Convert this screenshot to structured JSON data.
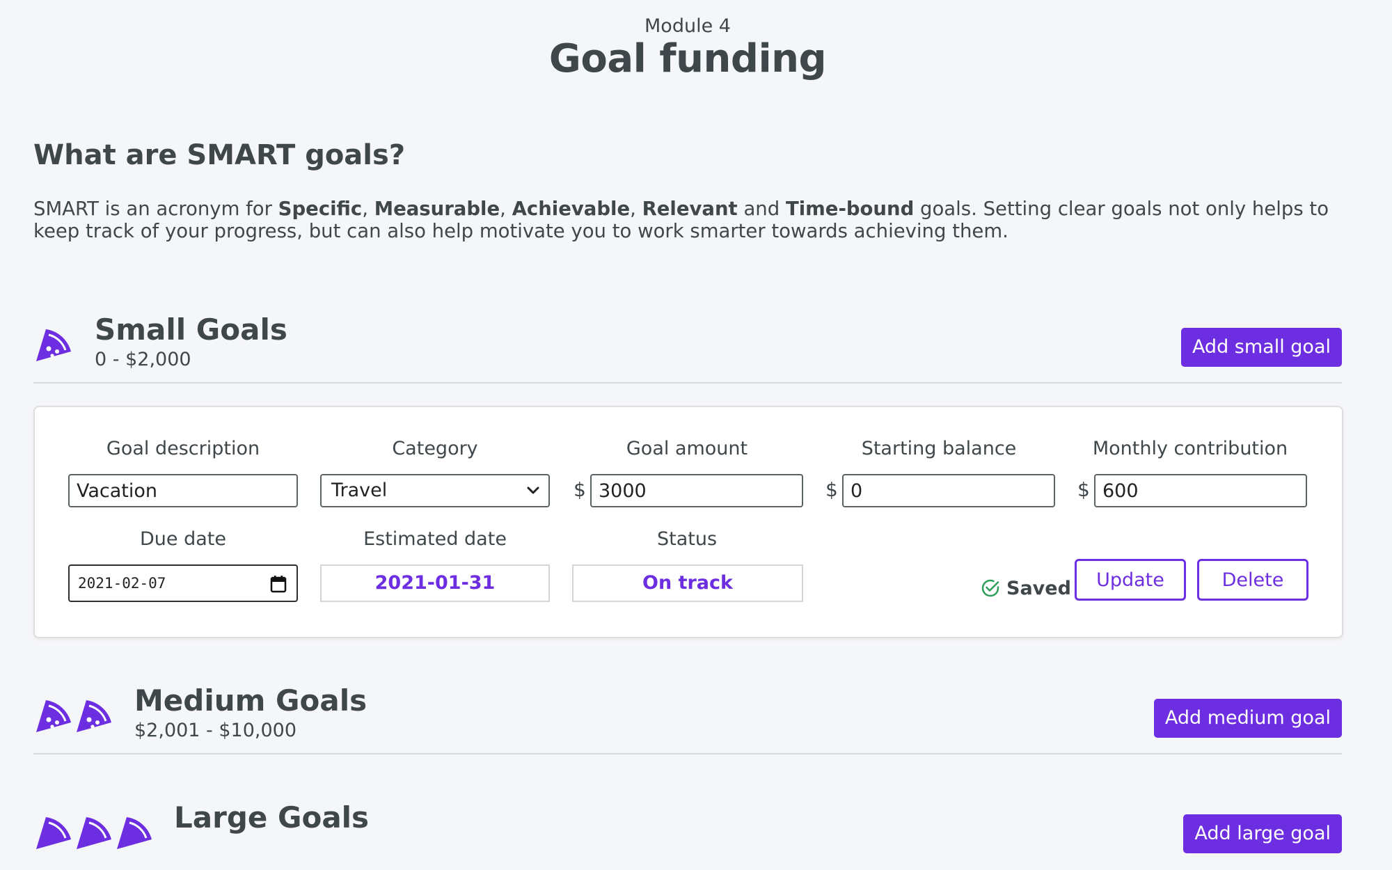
{
  "header": {
    "module_label": "Module 4",
    "title": "Goal funding"
  },
  "intro": {
    "heading": "What are SMART goals?",
    "text_1": "SMART is an acronym for ",
    "term_1": "Specific",
    "sep_1": ", ",
    "term_2": "Measurable",
    "sep_2": ", ",
    "term_3": "Achievable",
    "sep_3": ", ",
    "term_4": "Relevant",
    "and": " and ",
    "term_5": "Time-bound",
    "text_2": " goals. Setting clear goals not only helps to keep track of your progress, but can also help motivate you to work smarter towards achieving them."
  },
  "sections": {
    "small": {
      "title": "Small Goals",
      "range": "0 - $2,000",
      "add_label": "Add small goal",
      "icon_count": 1
    },
    "medium": {
      "title": "Medium Goals",
      "range": "$2,001 - $10,000",
      "add_label": "Add medium goal",
      "icon_count": 2
    },
    "large": {
      "title": "Large Goals",
      "range": "",
      "add_label": "Add large goal",
      "icon_count": 3
    }
  },
  "goal_card": {
    "labels": {
      "description": "Goal description",
      "category": "Category",
      "amount": "Goal amount",
      "starting_balance": "Starting balance",
      "monthly": "Monthly contribution",
      "due_date": "Due date",
      "estimated_date": "Estimated date",
      "status": "Status"
    },
    "currency_symbol": "$",
    "description_value": "Vacation",
    "category_value": "Travel",
    "amount_value": "3000",
    "starting_balance_value": "0",
    "monthly_value": "600",
    "due_date_value": "2021-02-07",
    "estimated_date_value": "2021-01-31",
    "status_value": "On track",
    "saved_label": "Saved",
    "update_label": "Update",
    "delete_label": "Delete"
  },
  "colors": {
    "accent": "#6c2ee0",
    "text": "#3f474b",
    "background": "#f5f6f8",
    "saved_check": "#2e9e5b"
  },
  "icons": {
    "tier_icon": "pizza-slice-icon",
    "saved": "check-circle-icon",
    "select": "chevron-down-icon",
    "date": "calendar-icon"
  }
}
